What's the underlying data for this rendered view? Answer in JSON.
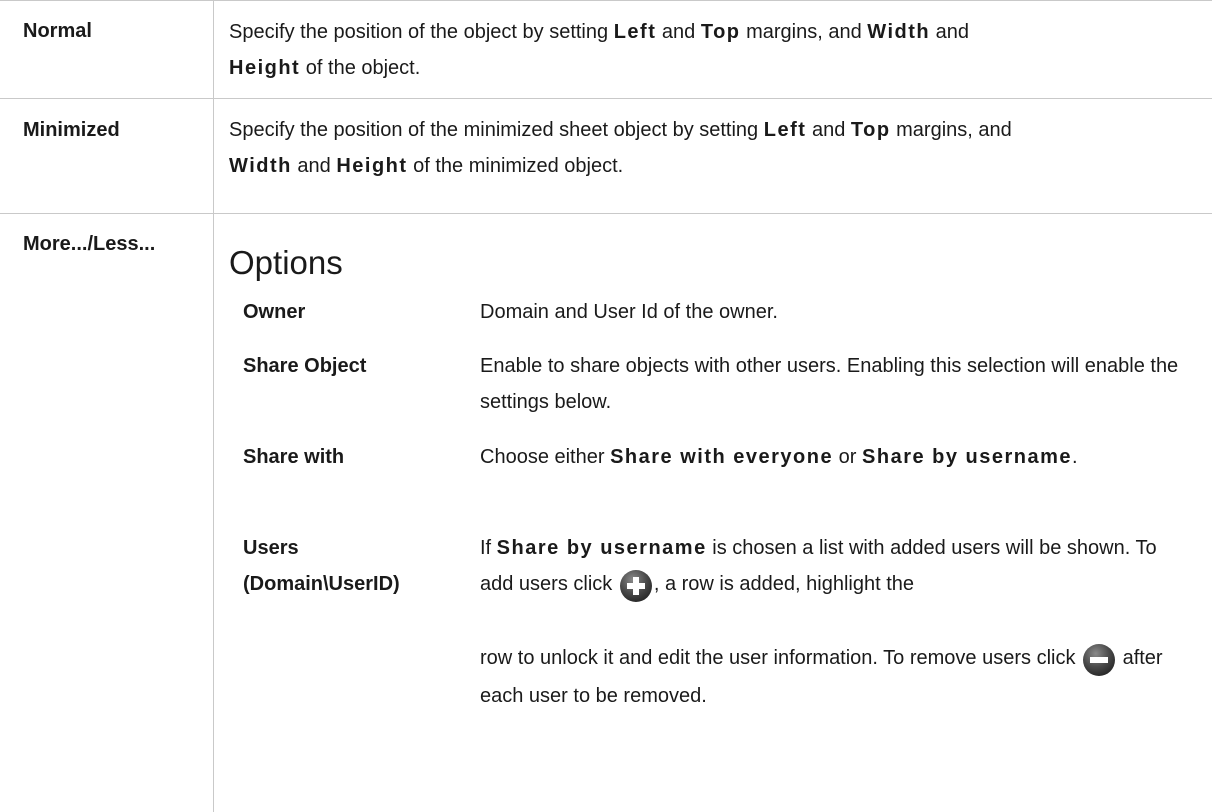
{
  "rows": [
    {
      "label": "Normal",
      "desc": {
        "t1": "Specify the position of the object by setting ",
        "k1": "Left",
        "t2": " and ",
        "k2": "Top",
        "t3": " margins, and ",
        "k3": "Width",
        "t4": " and ",
        "k4": "Height",
        "t5": " of the object."
      }
    },
    {
      "label": "Minimized",
      "desc": {
        "t1": "Specify the position of the minimized sheet object by setting ",
        "k1": "Left",
        "t2": " and ",
        "k2": "Top",
        "t3": " margins, and ",
        "k3": "Width",
        "t4": " and ",
        "k4": "Height",
        "t5": " of the minimized object."
      }
    },
    {
      "label": "More.../Less..."
    }
  ],
  "options": {
    "heading": "Options",
    "items": [
      {
        "label": "Owner",
        "desc": "Domain and User Id of the owner."
      },
      {
        "label": "Share Object",
        "desc": "Enable to share objects with other users. Enabling this selection will enable the settings below."
      },
      {
        "label": "Share with",
        "desc": {
          "t1": "Choose either ",
          "k1": "Share with everyone",
          "t2": " or ",
          "k2": "Share by username",
          "t3": "."
        }
      },
      {
        "label_line1": "Users",
        "label_line2": "(Domain\\UserID)",
        "desc": {
          "t1": "If ",
          "k1": "Share by username",
          "t2": " is chosen a list with added users will be shown. To add users click ",
          "t3": ", a row is added, highlight the",
          "t4": "row to unlock it and edit the user information. To remove users click ",
          "t5": " after each user to be removed."
        }
      }
    ]
  },
  "icons": {
    "add": "add-circle-icon",
    "remove": "remove-circle-icon"
  },
  "colors": {
    "border": "#c9c9c9",
    "text": "#1a1a1a",
    "icon_fill": "#4a4a4a"
  }
}
